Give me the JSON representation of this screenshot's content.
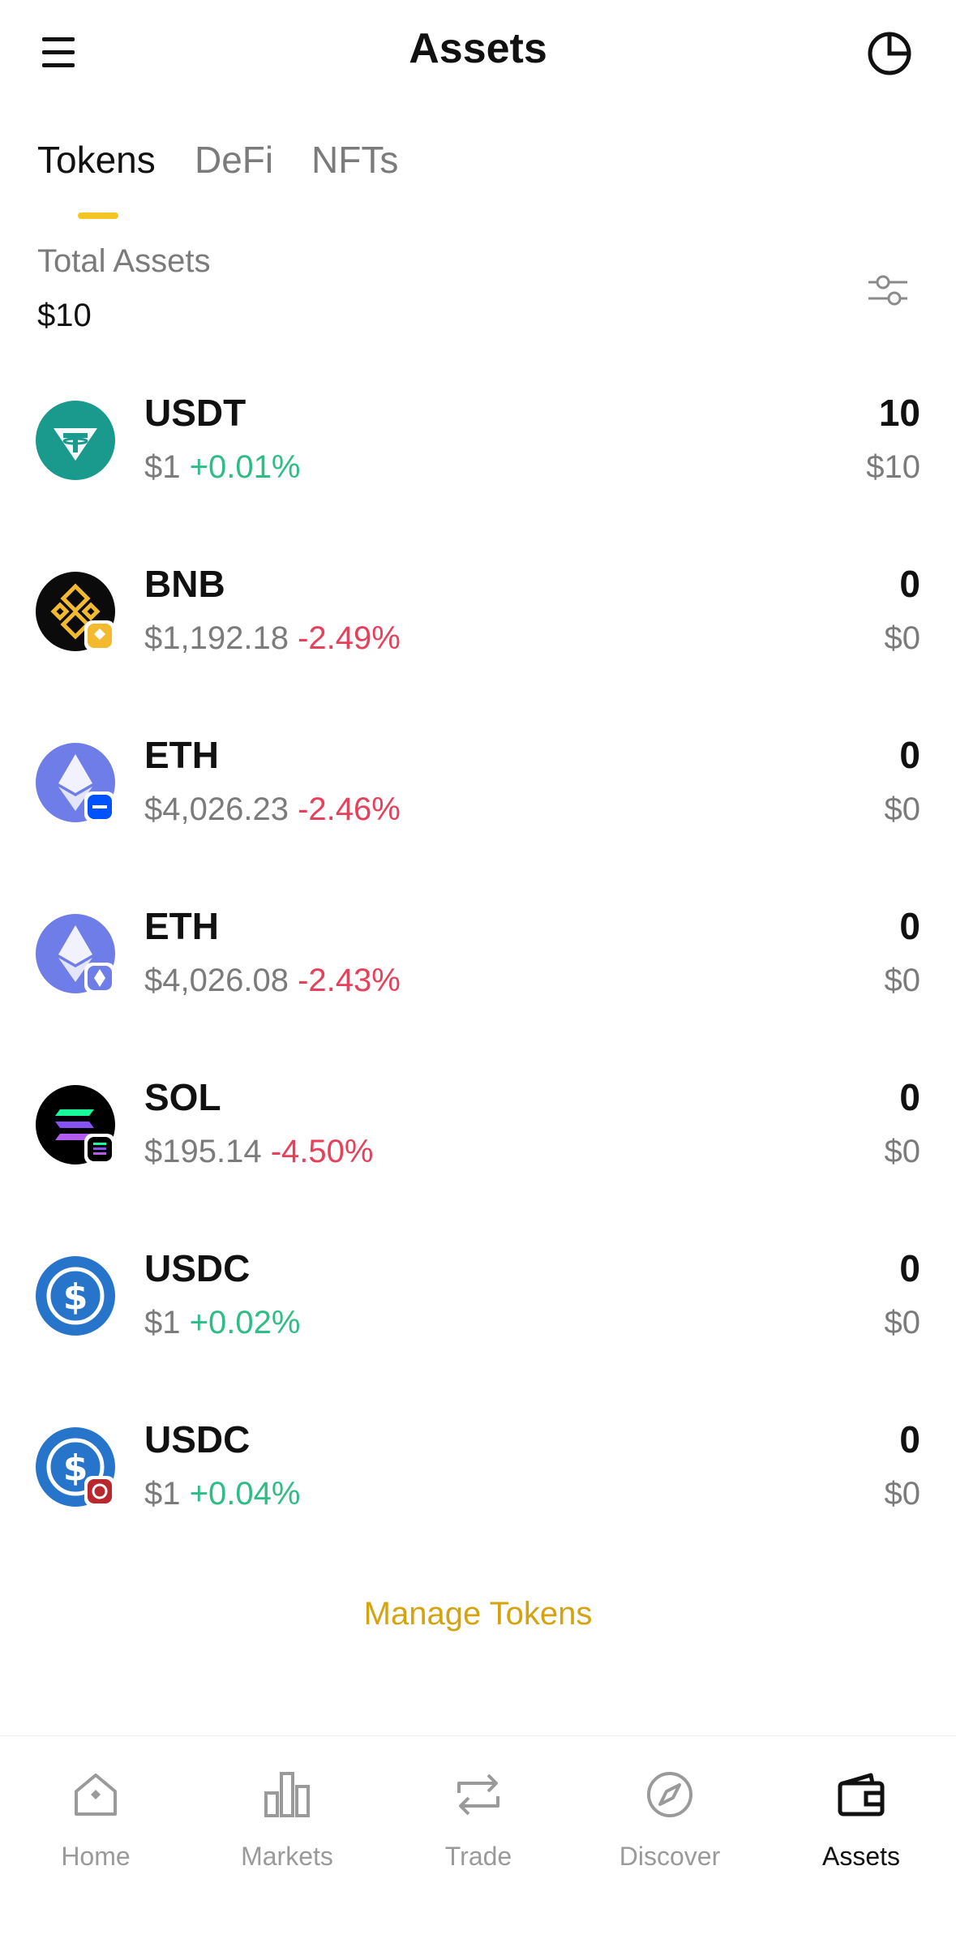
{
  "header": {
    "title": "Assets",
    "menu_icon": "hamburger-menu-icon",
    "right_icon": "pie-chart-icon"
  },
  "tabs": [
    {
      "label": "Tokens",
      "active": true
    },
    {
      "label": "DeFi",
      "active": false
    },
    {
      "label": "NFTs",
      "active": false
    }
  ],
  "summary": {
    "label": "Total Assets",
    "value": "$10",
    "filter_icon": "sliders-icon"
  },
  "tokens": [
    {
      "symbol": "USDT",
      "price": "$1",
      "change": "+0.01%",
      "amount": "10",
      "value": "$10",
      "icon": "usdt-icon"
    },
    {
      "symbol": "BNB",
      "price": "$1,192.18",
      "change": "-2.49%",
      "amount": "0",
      "value": "$0",
      "icon": "bnb-icon"
    },
    {
      "symbol": "ETH",
      "price": "$4,026.23",
      "change": "-2.46%",
      "amount": "0",
      "value": "$0",
      "icon": "eth-icon"
    },
    {
      "symbol": "ETH",
      "price": "$4,026.08",
      "change": "-2.43%",
      "amount": "0",
      "value": "$0",
      "icon": "eth-icon"
    },
    {
      "symbol": "SOL",
      "price": "$195.14",
      "change": "-4.50%",
      "amount": "0",
      "value": "$0",
      "icon": "sol-icon"
    },
    {
      "symbol": "USDC",
      "price": "$1",
      "change": "+0.02%",
      "amount": "0",
      "value": "$0",
      "icon": "usdc-icon"
    },
    {
      "symbol": "USDC",
      "price": "$1",
      "change": "+0.04%",
      "amount": "0",
      "value": "$0",
      "icon": "usdc-icon"
    }
  ],
  "manage_label": "Manage Tokens",
  "bottom_nav": [
    {
      "label": "Home",
      "icon": "home-icon",
      "active": false
    },
    {
      "label": "Markets",
      "icon": "bar-chart-icon",
      "active": false
    },
    {
      "label": "Trade",
      "icon": "swap-arrows-icon",
      "active": false
    },
    {
      "label": "Discover",
      "icon": "compass-icon",
      "active": false
    },
    {
      "label": "Assets",
      "icon": "wallet-icon",
      "active": true
    }
  ],
  "colors": {
    "accent": "#f3c625",
    "positive": "#2ebd85",
    "negative": "#e6415b",
    "link": "#d4a30f"
  }
}
